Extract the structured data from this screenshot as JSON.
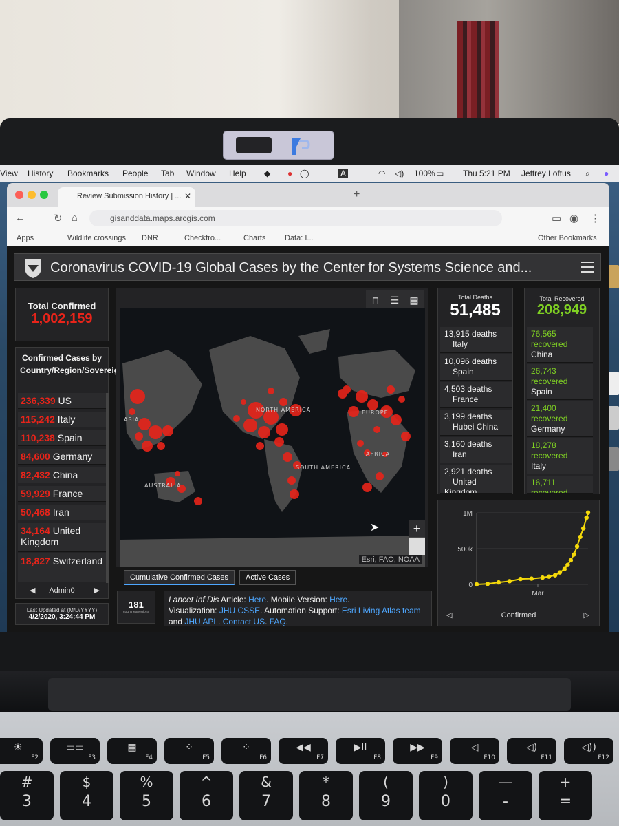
{
  "menubar": {
    "items": [
      "View",
      "History",
      "Bookmarks",
      "People",
      "Tab",
      "Window",
      "Help"
    ],
    "battery": "100%",
    "clock": "Thu 5:21 PM",
    "user": "Jeffrey Loftus"
  },
  "browser": {
    "tab1_title": "Review Submission History | ...",
    "tab2_title": "",
    "url": "gisanddata.maps.arcgis.com",
    "bookmarks": [
      "Apps",
      "Wildlife crossings",
      "DNR",
      "Checkfro...",
      "Charts",
      "Data: I...",
      "Other Bookmarks"
    ]
  },
  "dashboard": {
    "title": "Coronavirus COVID-19 Global Cases by the Center for Systems Science and...",
    "total_confirmed_label": "Total Confirmed",
    "total_confirmed_value": "1,002,159",
    "confirmed_by_country_label": "Confirmed Cases by Country/Region/Sovereignty",
    "confirmed_by_country": [
      {
        "count": "236,339",
        "place": "US"
      },
      {
        "count": "115,242",
        "place": "Italy"
      },
      {
        "count": "110,238",
        "place": "Spain"
      },
      {
        "count": "84,600",
        "place": "Germany"
      },
      {
        "count": "82,432",
        "place": "China"
      },
      {
        "count": "59,929",
        "place": "France"
      },
      {
        "count": "50,468",
        "place": "Iran"
      },
      {
        "count": "34,164",
        "place": "United Kingdom"
      },
      {
        "count": "18,827",
        "place": "Switzerland"
      }
    ],
    "admin_nav_label": "Admin0",
    "last_updated_label": "Last Updated at (M/D/YYYY)",
    "last_updated_value": "4/2/2020, 3:24:44 PM",
    "country_count": "181",
    "country_count_label": "countries/regions",
    "map": {
      "region_labels": [
        "ASIA",
        "NORTH AMERICA",
        "EUROPE",
        "AFRICA",
        "SOUTH AMERICA",
        "AUSTRALIA"
      ],
      "attribution": "Esri, FAO, NOAA",
      "tabs": [
        "Cumulative Confirmed Cases",
        "Active Cases"
      ]
    },
    "total_deaths_label": "Total Deaths",
    "total_deaths_value": "51,485",
    "deaths": [
      {
        "count": "13,915 deaths",
        "place": "Italy"
      },
      {
        "count": "10,096 deaths",
        "place": "Spain"
      },
      {
        "count": "4,503 deaths",
        "place": "France"
      },
      {
        "count": "3,199 deaths",
        "place": "Hubei China"
      },
      {
        "count": "3,160 deaths",
        "place": "Iran"
      },
      {
        "count": "2,921 deaths",
        "place": "United Kingdom"
      }
    ],
    "total_recovered_label": "Total Recovered",
    "total_recovered_value": "208,949",
    "recovered": [
      {
        "count": "76,565",
        "word": "recovered",
        "place": "China"
      },
      {
        "count": "26,743",
        "word": "recovered",
        "place": "Spain"
      },
      {
        "count": "21,400",
        "word": "recovered",
        "place": "Germany"
      },
      {
        "count": "18,278",
        "word": "recovered",
        "place": "Italy"
      },
      {
        "count": "16,711",
        "word": "recovered",
        "place": ""
      }
    ],
    "lancet": {
      "p1": "Lancet Inf Dis",
      "p2": " Article: ",
      "l1": "Here",
      "p3": ". Mobile Version: ",
      "l2": "Here",
      "p4": ".",
      "p5": "Visualization: ",
      "l3": "JHU CSSE",
      "p6": ". Automation Support: ",
      "l4": "Esri Living Atlas team",
      "p7": " and ",
      "l5": "JHU APL",
      "p8": ". ",
      "l6": "Contact US",
      "p9": ". ",
      "l7": "FAQ",
      "p10": "."
    },
    "chart_nav_label": "Confirmed"
  },
  "keyboard": {
    "fn_keys": [
      {
        "fn": "F2",
        "icon": "☀"
      },
      {
        "fn": "F3",
        "icon": "▭▭"
      },
      {
        "fn": "F4",
        "icon": "▦"
      },
      {
        "fn": "F5",
        "icon": "⁘"
      },
      {
        "fn": "F6",
        "icon": "⁘"
      },
      {
        "fn": "F7",
        "icon": "◀◀"
      },
      {
        "fn": "F8",
        "icon": "▶II"
      },
      {
        "fn": "F9",
        "icon": "▶▶"
      },
      {
        "fn": "F10",
        "icon": "◁"
      },
      {
        "fn": "F11",
        "icon": "◁)"
      },
      {
        "fn": "F12",
        "icon": "◁))"
      }
    ],
    "num_keys": [
      {
        "up": "#",
        "dn": "3"
      },
      {
        "up": "$",
        "dn": "4"
      },
      {
        "up": "%",
        "dn": "5"
      },
      {
        "up": "^",
        "dn": "6"
      },
      {
        "up": "&",
        "dn": "7"
      },
      {
        "up": "*",
        "dn": "8"
      },
      {
        "up": "(",
        "dn": "9"
      },
      {
        "up": ")",
        "dn": "0"
      },
      {
        "up": "—",
        "dn": "-"
      },
      {
        "up": "+",
        "dn": "="
      }
    ]
  },
  "chart_data": {
    "type": "line",
    "title": "",
    "xlabel": "Confirmed",
    "ylabel": "",
    "x_tick_labels": [
      "Mar"
    ],
    "y_tick_labels": [
      "0",
      "500k",
      "1M"
    ],
    "ylim": [
      0,
      1000000
    ],
    "x": [
      "2020-01-22",
      "2020-01-29",
      "2020-02-05",
      "2020-02-12",
      "2020-02-19",
      "2020-02-26",
      "2020-03-04",
      "2020-03-08",
      "2020-03-12",
      "2020-03-15",
      "2020-03-18",
      "2020-03-20",
      "2020-03-22",
      "2020-03-24",
      "2020-03-26",
      "2020-03-28",
      "2020-03-30",
      "2020-04-01",
      "2020-04-02"
    ],
    "series": [
      {
        "values": [
          555,
          7800,
          28000,
          45000,
          76000,
          81000,
          95000,
          109000,
          128000,
          167000,
          214000,
          272000,
          337000,
          418000,
          530000,
          663000,
          782000,
          932000,
          1002159
        ]
      }
    ],
    "color": "#f5d90a"
  }
}
